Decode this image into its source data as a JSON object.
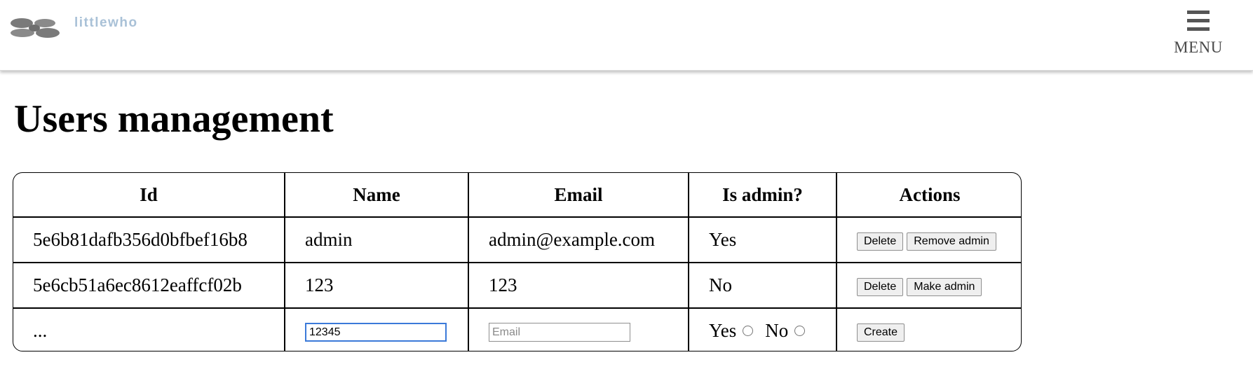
{
  "header": {
    "logo_text": "littlewho",
    "menu_label": "MENU"
  },
  "page": {
    "title": "Users management"
  },
  "table": {
    "columns": [
      "Id",
      "Name",
      "Email",
      "Is admin?",
      "Actions"
    ],
    "rows": [
      {
        "id": "5e6b81dafb356d0bfbef16b8",
        "name": "admin",
        "email": "admin@example.com",
        "is_admin": "Yes",
        "actions": [
          "Delete",
          "Remove admin"
        ]
      },
      {
        "id": "5e6cb51a6ec8612eaffcf02b",
        "name": "123",
        "email": "123",
        "is_admin": "No",
        "actions": [
          "Delete",
          "Make admin"
        ]
      }
    ],
    "new_row": {
      "id_placeholder": "...",
      "name_value": "12345",
      "email_placeholder": "Email",
      "yes_label": "Yes",
      "no_label": "No",
      "create_label": "Create"
    }
  },
  "colors": {
    "logo": "#a9c1d7",
    "menu_icon": "#555555",
    "focus": "#3b7ad9"
  },
  "icons": {
    "logo": "clover-logo-icon",
    "menu": "hamburger-menu-icon"
  }
}
